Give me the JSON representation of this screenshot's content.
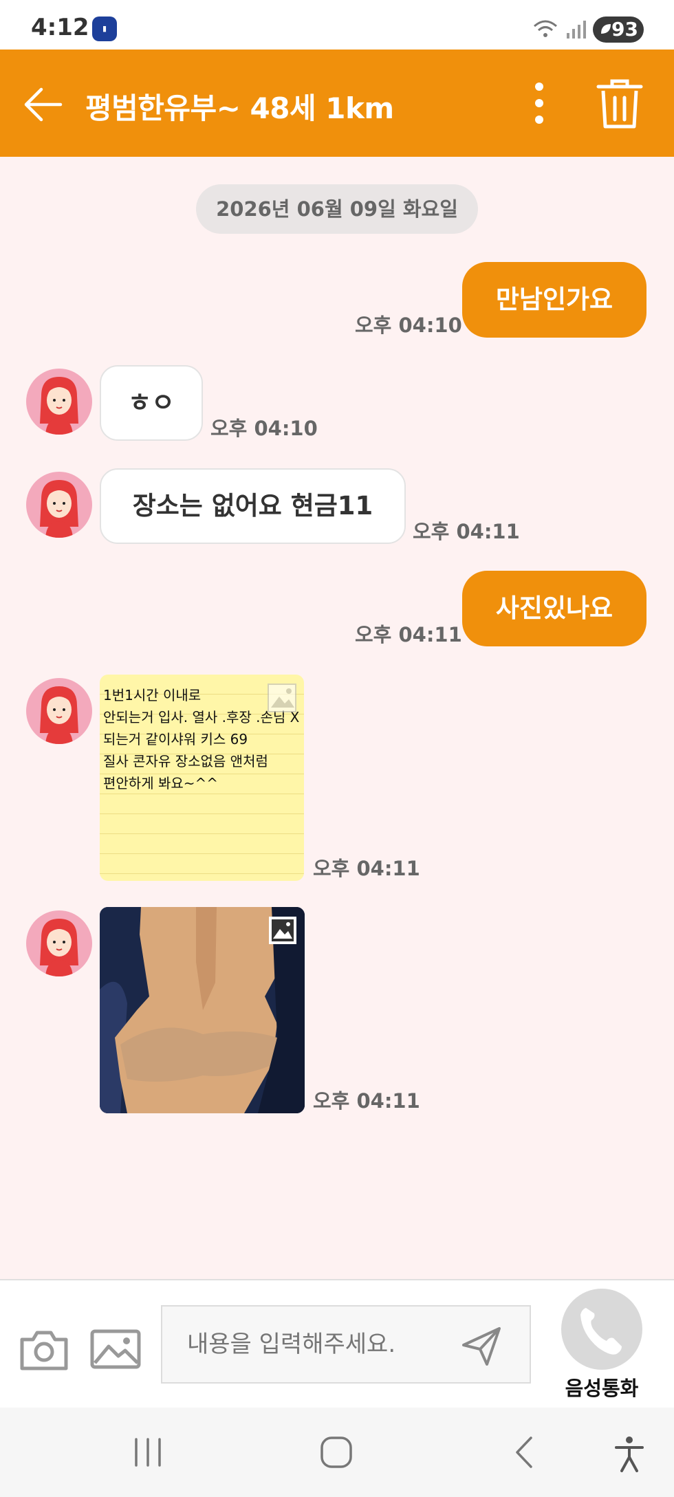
{
  "status_bar": {
    "time": "4:12",
    "battery": "93"
  },
  "header": {
    "title": "평범한유부~ 48세 1km",
    "color": "#f0900c"
  },
  "chat": {
    "date": "2026년 06월 09일 화요일",
    "messages": [
      {
        "direction": "out",
        "text": "만남인가요",
        "time": "오후 04:10"
      },
      {
        "direction": "in",
        "text": "ㅎㅇ",
        "time": "오후 04:10"
      },
      {
        "direction": "in",
        "text": "장소는 없어요 현금11",
        "time": "오후 04:11"
      },
      {
        "direction": "out",
        "text": "사진있나요",
        "time": "오후 04:11"
      },
      {
        "direction": "in",
        "type": "image-note",
        "lines": [
          "1번1시간 이내로",
          "안되는거 입사. 열사 .후장 .손님 X",
          "되는거 같이샤워 키스 69",
          "질사 콘자유 장소없음 앤처럼",
          "편안하게 봐요~^^"
        ],
        "time": "오후 04:11"
      },
      {
        "direction": "in",
        "type": "image-photo",
        "time": "오후 04:11"
      }
    ]
  },
  "input": {
    "placeholder": "내용을 입력해주세요.",
    "call_label": "음성통화"
  },
  "icons": {
    "back": "arrow-left-icon",
    "more": "more-vertical-icon",
    "delete": "trash-icon",
    "camera": "camera-icon",
    "gallery": "image-icon",
    "send": "send-icon",
    "call": "phone-icon"
  }
}
